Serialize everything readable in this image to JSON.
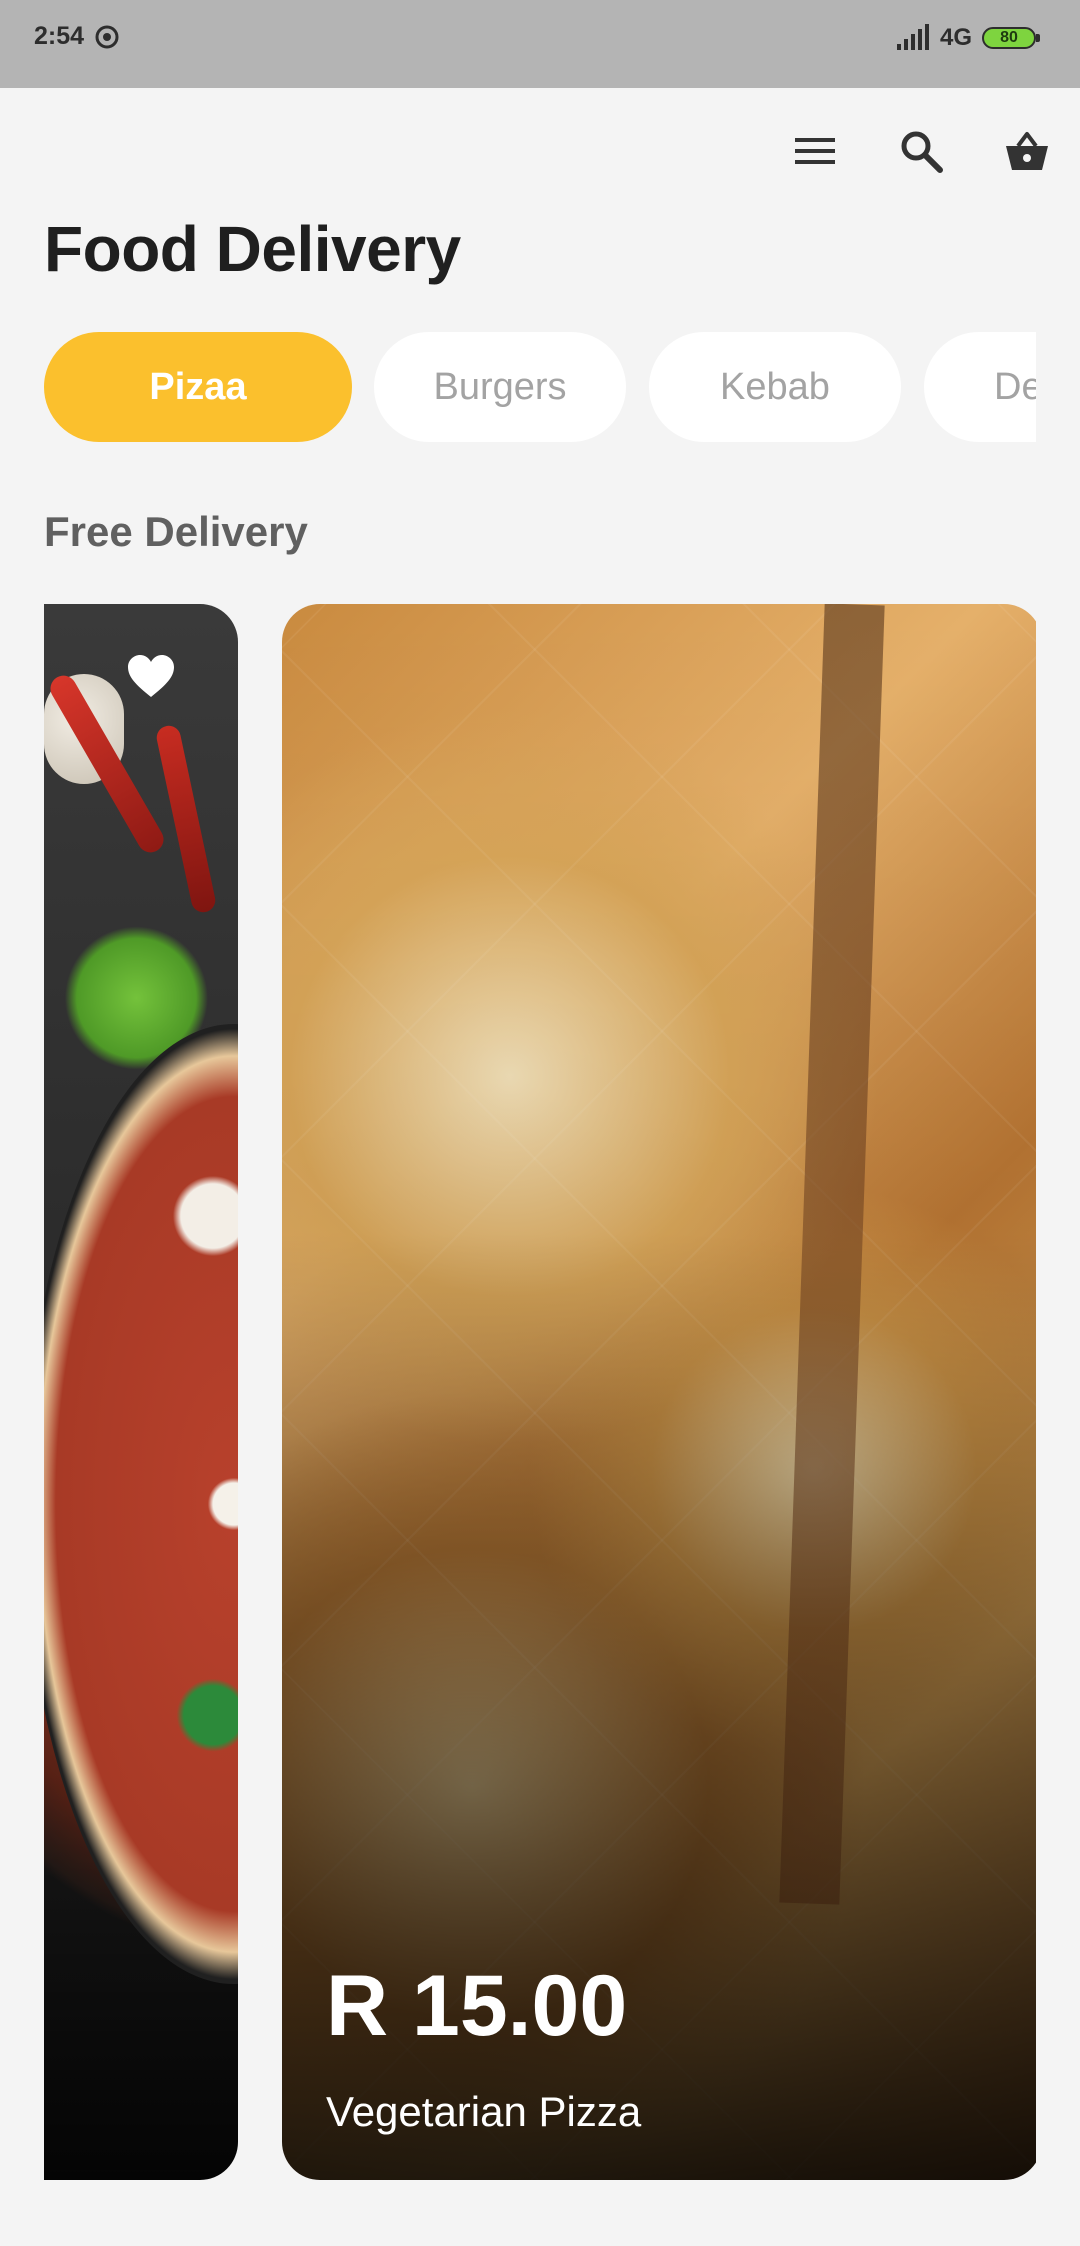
{
  "status_bar": {
    "time": "2:54",
    "network": "4G",
    "battery": "80"
  },
  "toolbar": {
    "icons": [
      "menu-icon",
      "search-icon",
      "basket-icon"
    ]
  },
  "page": {
    "title": "Food Delivery"
  },
  "categories": [
    {
      "label": "Pizaa",
      "active": true
    },
    {
      "label": "Burgers",
      "active": false
    },
    {
      "label": "Kebab",
      "active": false
    },
    {
      "label": "De",
      "active": false
    }
  ],
  "section": {
    "title": "Free Delivery"
  },
  "cards": [
    {
      "favorite": true
    },
    {
      "price": "R 15.00",
      "name": "Vegetarian Pizza"
    }
  ],
  "colors": {
    "accent": "#fbc02d",
    "background": "#f4f4f4",
    "status_bar": "#b4b4b4"
  }
}
